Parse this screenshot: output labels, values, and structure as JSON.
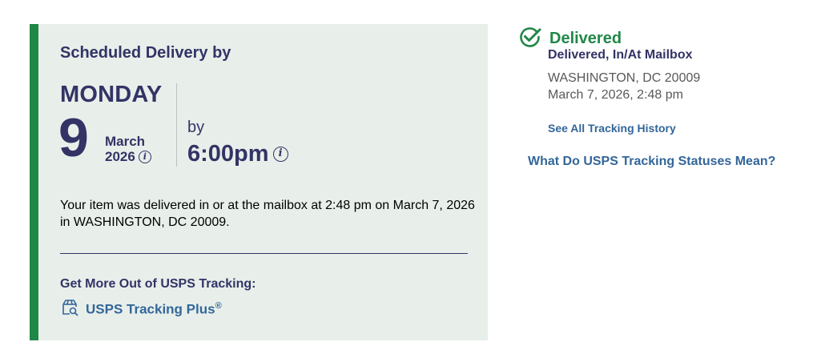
{
  "delivery": {
    "scheduled_title": "Scheduled Delivery by",
    "day": "MONDAY",
    "date_num": "9",
    "month": "March",
    "year": "2026",
    "by_label": "by",
    "time": "6:00pm",
    "description": "Your item was delivered in or at the mailbox at 2:48 pm on March 7, 2026 in WASHINGTON, DC 20009.",
    "more_title": "Get More Out of USPS Tracking:",
    "tracking_plus_label": "USPS Tracking Plus",
    "tracking_plus_mark": "®"
  },
  "status": {
    "label": "Delivered",
    "detail": "Delivered, In/At Mailbox",
    "location": "WASHINGTON, DC 20009",
    "datetime": "March 7, 2026, 2:48 pm",
    "history_link": "See All Tracking History",
    "statuses_link": "What Do USPS Tracking Statuses Mean?"
  },
  "icons": {
    "info": "info-icon",
    "check": "check-circle-icon",
    "tracking_plus": "package-search-icon"
  },
  "colors": {
    "accent_green": "#218748",
    "navy": "#333366",
    "link_blue": "#336699",
    "panel_bg": "#e8efea"
  }
}
